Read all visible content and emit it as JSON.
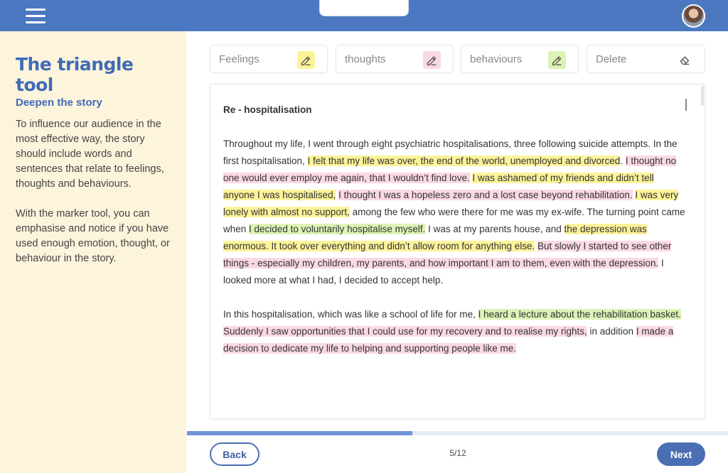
{
  "header": {
    "menu_icon": "hamburger-menu-icon",
    "avatar_icon": "user-avatar"
  },
  "sidebar": {
    "title": "The triangle tool",
    "subtitle": "Deepen the story",
    "paragraph1": "To influence our audience in the most effective way, the story should include words and sentences that relate to feelings, thoughts and behaviours.",
    "paragraph2": "With the marker tool, you can emphasise and notice if you have used enough emotion, thought, or behaviour in the story."
  },
  "tools": {
    "feelings": {
      "label": "Feelings",
      "icon": "marker-pen-icon",
      "color": "#fbf39a"
    },
    "thoughts": {
      "label": "thoughts",
      "icon": "marker-pen-icon",
      "color": "#fbd9e4"
    },
    "behaviours": {
      "label": "behaviours",
      "icon": "marker-pen-icon",
      "color": "#ddf3b5"
    },
    "delete": {
      "label": "Delete",
      "icon": "eraser-icon"
    }
  },
  "document": {
    "title": "Re - hospitalisation",
    "p1": [
      {
        "text": "Throughout my life, I went through eight psychiatric hospitalisations, three following suicide attempts. In the first hospitalisation, ",
        "hl": ""
      },
      {
        "text": "I felt that my life was over, the end of the world, unemployed and divorced",
        "hl": "y"
      },
      {
        "text": ". ",
        "hl": ""
      },
      {
        "text": "I thought no one would ever employ me again, that I wouldn’t find love.",
        "hl": "p"
      },
      {
        "text": " ",
        "hl": ""
      },
      {
        "text": "I was ashamed of my friends and didn’t tell anyone I was hospitalised,",
        "hl": "y"
      },
      {
        "text": " ",
        "hl": ""
      },
      {
        "text": "I thought I was a hopeless zero and a lost case beyond rehabilitation.",
        "hl": "p"
      },
      {
        "text": " ",
        "hl": ""
      },
      {
        "text": "I was very lonely with almost no support,",
        "hl": "y"
      },
      {
        "text": " among the few who were there for me was my ex-wife. The turning point came when ",
        "hl": ""
      },
      {
        "text": "I decided to voluntarily hospitalise myself.",
        "hl": "g"
      },
      {
        "text": " I was at my parents house, and ",
        "hl": ""
      },
      {
        "text": "the depression was enormous. It took over everything and didn’t allow room for anything else.",
        "hl": "y"
      },
      {
        "text": " ",
        "hl": ""
      },
      {
        "text": "But slowly I started to see other things - especially my children, my parents, and how important I am to them, even with the depression.",
        "hl": "p"
      },
      {
        "text": " I looked more at what I had, I decided to accept help.",
        "hl": ""
      }
    ],
    "p2": [
      {
        "text": "In this hospitalisation, which was like a school of life for me, ",
        "hl": ""
      },
      {
        "text": "I heard a lecture about the rehabilitation basket.",
        "hl": "g"
      },
      {
        "text": " ",
        "hl": ""
      },
      {
        "text": "Suddenly I saw opportunities that I could use for my recovery and to realise my rights,",
        "hl": "p"
      },
      {
        "text": " in addition ",
        "hl": ""
      },
      {
        "text": "I made a decision to dedicate my life to helping and supporting people like me.",
        "hl": "p"
      }
    ]
  },
  "progress": {
    "fraction": 0.417
  },
  "nav": {
    "back_label": "Back",
    "next_label": "Next",
    "page": "5/12"
  }
}
